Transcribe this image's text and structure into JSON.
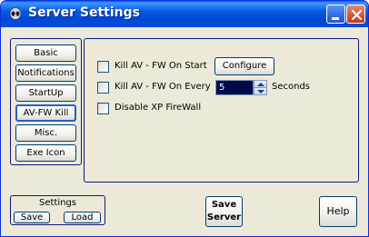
{
  "window": {
    "title": "Server Settings",
    "icon": "app-icon",
    "minimize_icon": "minimize-icon",
    "close_icon": "close-icon"
  },
  "nav": {
    "items": [
      {
        "label": "Basic",
        "active": false
      },
      {
        "label": "Notifications",
        "active": false
      },
      {
        "label": "StartUp",
        "active": false
      },
      {
        "label": "AV-FW Kill",
        "active": true
      },
      {
        "label": "Misc.",
        "active": false
      },
      {
        "label": "Exe Icon",
        "active": false
      }
    ]
  },
  "content": {
    "kill_on_start_label": "Kill AV - FW On Start",
    "kill_on_start_checked": false,
    "configure_label": "Configure",
    "kill_every_label": "Kill AV - FW On Every",
    "kill_every_checked": false,
    "kill_every_value": "5",
    "seconds_label": "Seconds",
    "disable_fw_label": "Disable XP FireWall",
    "disable_fw_checked": false
  },
  "settings": {
    "title": "Settings",
    "save_label": "Save",
    "load_label": "Load"
  },
  "save_server": {
    "line1": "Save",
    "line2": "Server"
  },
  "help_label": "Help",
  "colors": {
    "titlebar": "#0858e0",
    "frame_border": "#0b1a7c",
    "window_bg": "#ece9d8",
    "selected_input_bg": "#000a4a"
  }
}
